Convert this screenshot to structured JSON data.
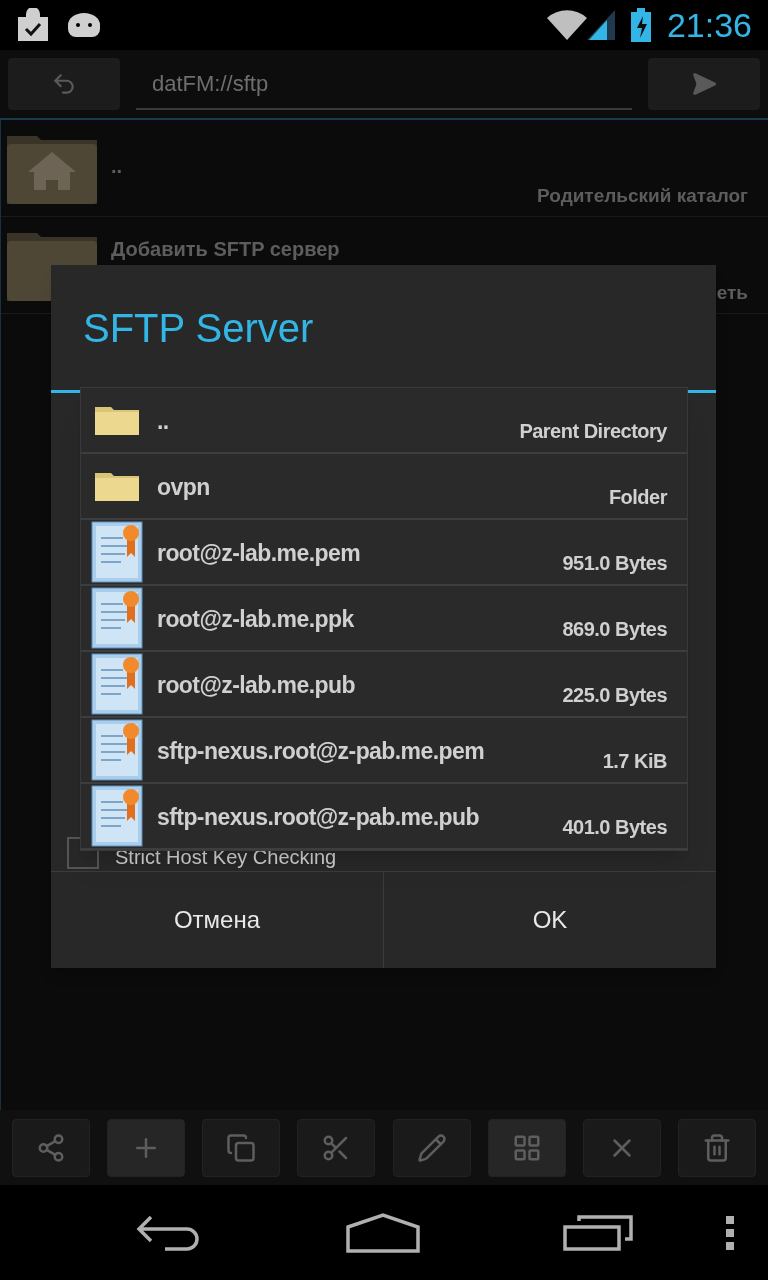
{
  "status_bar": {
    "time": "21:36"
  },
  "address_bar": {
    "value": "datFM://sftp"
  },
  "background_list": [
    {
      "kind": "parent",
      "name": "..",
      "detail": "Родительский каталог"
    },
    {
      "kind": "add",
      "name": "Добавить SFTP сервер",
      "detail": "еть"
    }
  ],
  "dialog": {
    "title": "SFTP Server",
    "checkbox": {
      "label": "Strict Host Key Checking",
      "checked": false
    },
    "buttons": [
      "Отмена",
      "OK"
    ]
  },
  "file_picker": [
    {
      "kind": "folder",
      "name": "..",
      "detail": "Parent Directory"
    },
    {
      "kind": "folder",
      "name": "ovpn",
      "detail": "Folder"
    },
    {
      "kind": "certificate",
      "name": "root@z-lab.me.pem",
      "detail": "951.0 Bytes"
    },
    {
      "kind": "certificate",
      "name": "root@z-lab.me.ppk",
      "detail": "869.0 Bytes"
    },
    {
      "kind": "certificate",
      "name": "root@z-lab.me.pub",
      "detail": "225.0 Bytes"
    },
    {
      "kind": "certificate",
      "name": "sftp-nexus.root@z-pab.me.pem",
      "detail": "1.7 KiB"
    },
    {
      "kind": "certificate",
      "name": "sftp-nexus.root@z-pab.me.pub",
      "detail": "401.0 Bytes"
    }
  ],
  "toolbar": [
    {
      "kind": "share",
      "active": false
    },
    {
      "kind": "add",
      "active": true
    },
    {
      "kind": "copy",
      "active": false
    },
    {
      "kind": "cut",
      "active": false
    },
    {
      "kind": "rename",
      "active": false
    },
    {
      "kind": "select",
      "active": true
    },
    {
      "kind": "cancel",
      "active": false
    },
    {
      "kind": "delete",
      "active": false
    }
  ]
}
